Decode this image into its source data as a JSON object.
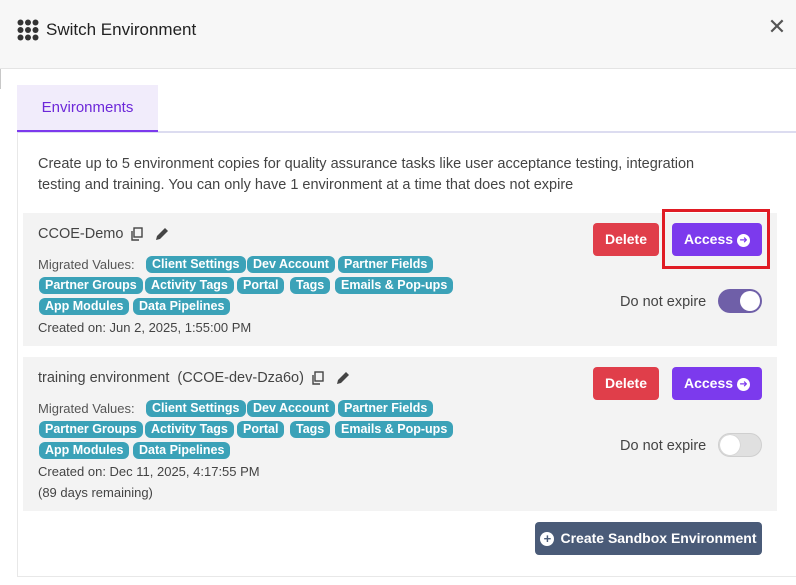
{
  "header": {
    "title": "Switch Environment",
    "icon": "grid-icon",
    "close_icon": "close-icon"
  },
  "tabs": [
    {
      "label": "Environments",
      "active": true
    }
  ],
  "intro_text": "Create up to 5 environment copies for quality assurance tasks like user acceptance testing, integration testing and training. You can only have 1 environment at a time that does not expire",
  "migrated_label": "Migrated Values:",
  "environments": [
    {
      "name": "CCOE-Demo",
      "tags": [
        "Client Settings",
        "Dev Account",
        "Partner Fields",
        "Partner Groups",
        "Activity Tags",
        "Portal",
        "Tags",
        "Emails & Pop-ups",
        "App Modules",
        "Data Pipelines"
      ],
      "created": "Created on: Jun 2, 2025, 1:55:00 PM",
      "delete_label": "Delete",
      "access_label": "Access",
      "toggle_label": "Do not expire",
      "do_not_expire": true
    },
    {
      "name": "training environment  (CCOE-dev-Dza6o)",
      "tags": [
        "Client Settings",
        "Dev Account",
        "Partner Fields",
        "Partner Groups",
        "Activity Tags",
        "Portal",
        "Tags",
        "Emails & Pop-ups",
        "App Modules",
        "Data Pipelines"
      ],
      "created": "Created on: Dec 11, 2025, 4:17:55 PM",
      "remaining": "(89 days remaining)",
      "delete_label": "Delete",
      "access_label": "Access",
      "toggle_label": "Do not expire",
      "do_not_expire": false
    }
  ],
  "create_button": {
    "label": "Create Sandbox Environment",
    "icon": "plus-circle-icon"
  },
  "colors": {
    "accent": "#7c3aed",
    "delete": "#e03e4a",
    "tag": "#3ba2b8",
    "create": "#4a5b78",
    "highlight": "#e01b24"
  }
}
